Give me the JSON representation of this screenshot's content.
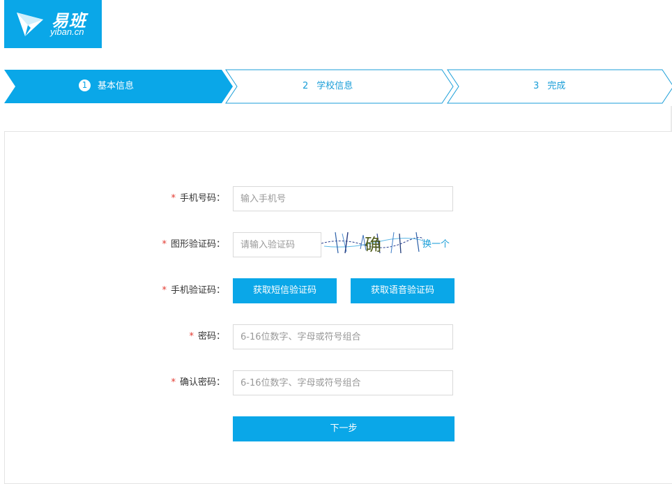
{
  "logo": {
    "cn": "易班",
    "en": "yiban.cn"
  },
  "steps": [
    {
      "num": "1",
      "label": "基本信息",
      "active": true
    },
    {
      "num": "2",
      "label": "学校信息",
      "active": false
    },
    {
      "num": "3",
      "label": "完成",
      "active": false
    }
  ],
  "form": {
    "phone": {
      "required": "*",
      "label": "手机号码：",
      "placeholder": "输入手机号",
      "value": ""
    },
    "captcha": {
      "required": "*",
      "label": "图形验证码：",
      "placeholder": "请输入验证码",
      "value": "",
      "image_text": "确",
      "refresh": "换一个"
    },
    "sms": {
      "required": "*",
      "label": "手机验证码：",
      "sms_button": "获取短信验证码",
      "voice_button": "获取语音验证码"
    },
    "password": {
      "required": "*",
      "label": "密码：",
      "placeholder": "6-16位数字、字母或符号组合",
      "value": ""
    },
    "confirm": {
      "required": "*",
      "label": "确认密码：",
      "placeholder": "6-16位数字、字母或符号组合",
      "value": ""
    },
    "next_button": "下一步"
  },
  "colors": {
    "primary": "#0aa7e8",
    "link": "#1a9ed8",
    "required": "#e2372e"
  }
}
